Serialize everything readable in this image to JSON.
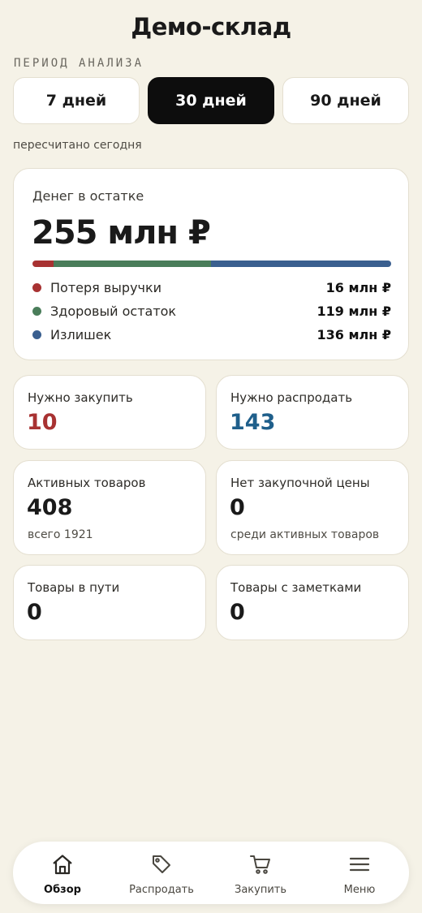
{
  "header": {
    "title": "Демо-склад"
  },
  "period": {
    "label": "ПЕРИОД АНАЛИЗА",
    "options": [
      "7 дней",
      "30 дней",
      "90 дней"
    ],
    "selected": "30 дней",
    "recalc_note": "пересчитано сегодня"
  },
  "money": {
    "label": "Денег в остатке",
    "total": "255 млн ₽",
    "segments": [
      {
        "name": "Потеря выручки",
        "value": "16 млн ₽",
        "amount": 16,
        "color": "#a83232"
      },
      {
        "name": "Здоровый остаток",
        "value": "119 млн ₽",
        "amount": 119,
        "color": "#4a7d5a"
      },
      {
        "name": "Излишек",
        "value": "136 млн ₽",
        "amount": 136,
        "color": "#3a5f8f"
      }
    ]
  },
  "stats": {
    "need_buy": {
      "label": "Нужно закупить",
      "value": "10",
      "color": "#a83232"
    },
    "need_sell": {
      "label": "Нужно распродать",
      "value": "143",
      "color": "#1f5f8b"
    },
    "active": {
      "label": "Активных товаров",
      "value": "408",
      "sub": "всего 1921"
    },
    "no_price": {
      "label": "Нет закупочной цены",
      "value": "0",
      "sub": "среди активных товаров"
    },
    "in_transit": {
      "label": "Товары в пути",
      "value": "0"
    },
    "with_notes": {
      "label": "Товары с заметками",
      "value": "0"
    }
  },
  "nav": {
    "items": [
      {
        "label": "Обзор",
        "icon": "home-icon",
        "active": true
      },
      {
        "label": "Распродать",
        "icon": "tag-icon",
        "active": false
      },
      {
        "label": "Закупить",
        "icon": "cart-icon",
        "active": false
      },
      {
        "label": "Меню",
        "icon": "menu-icon",
        "active": false
      }
    ]
  }
}
